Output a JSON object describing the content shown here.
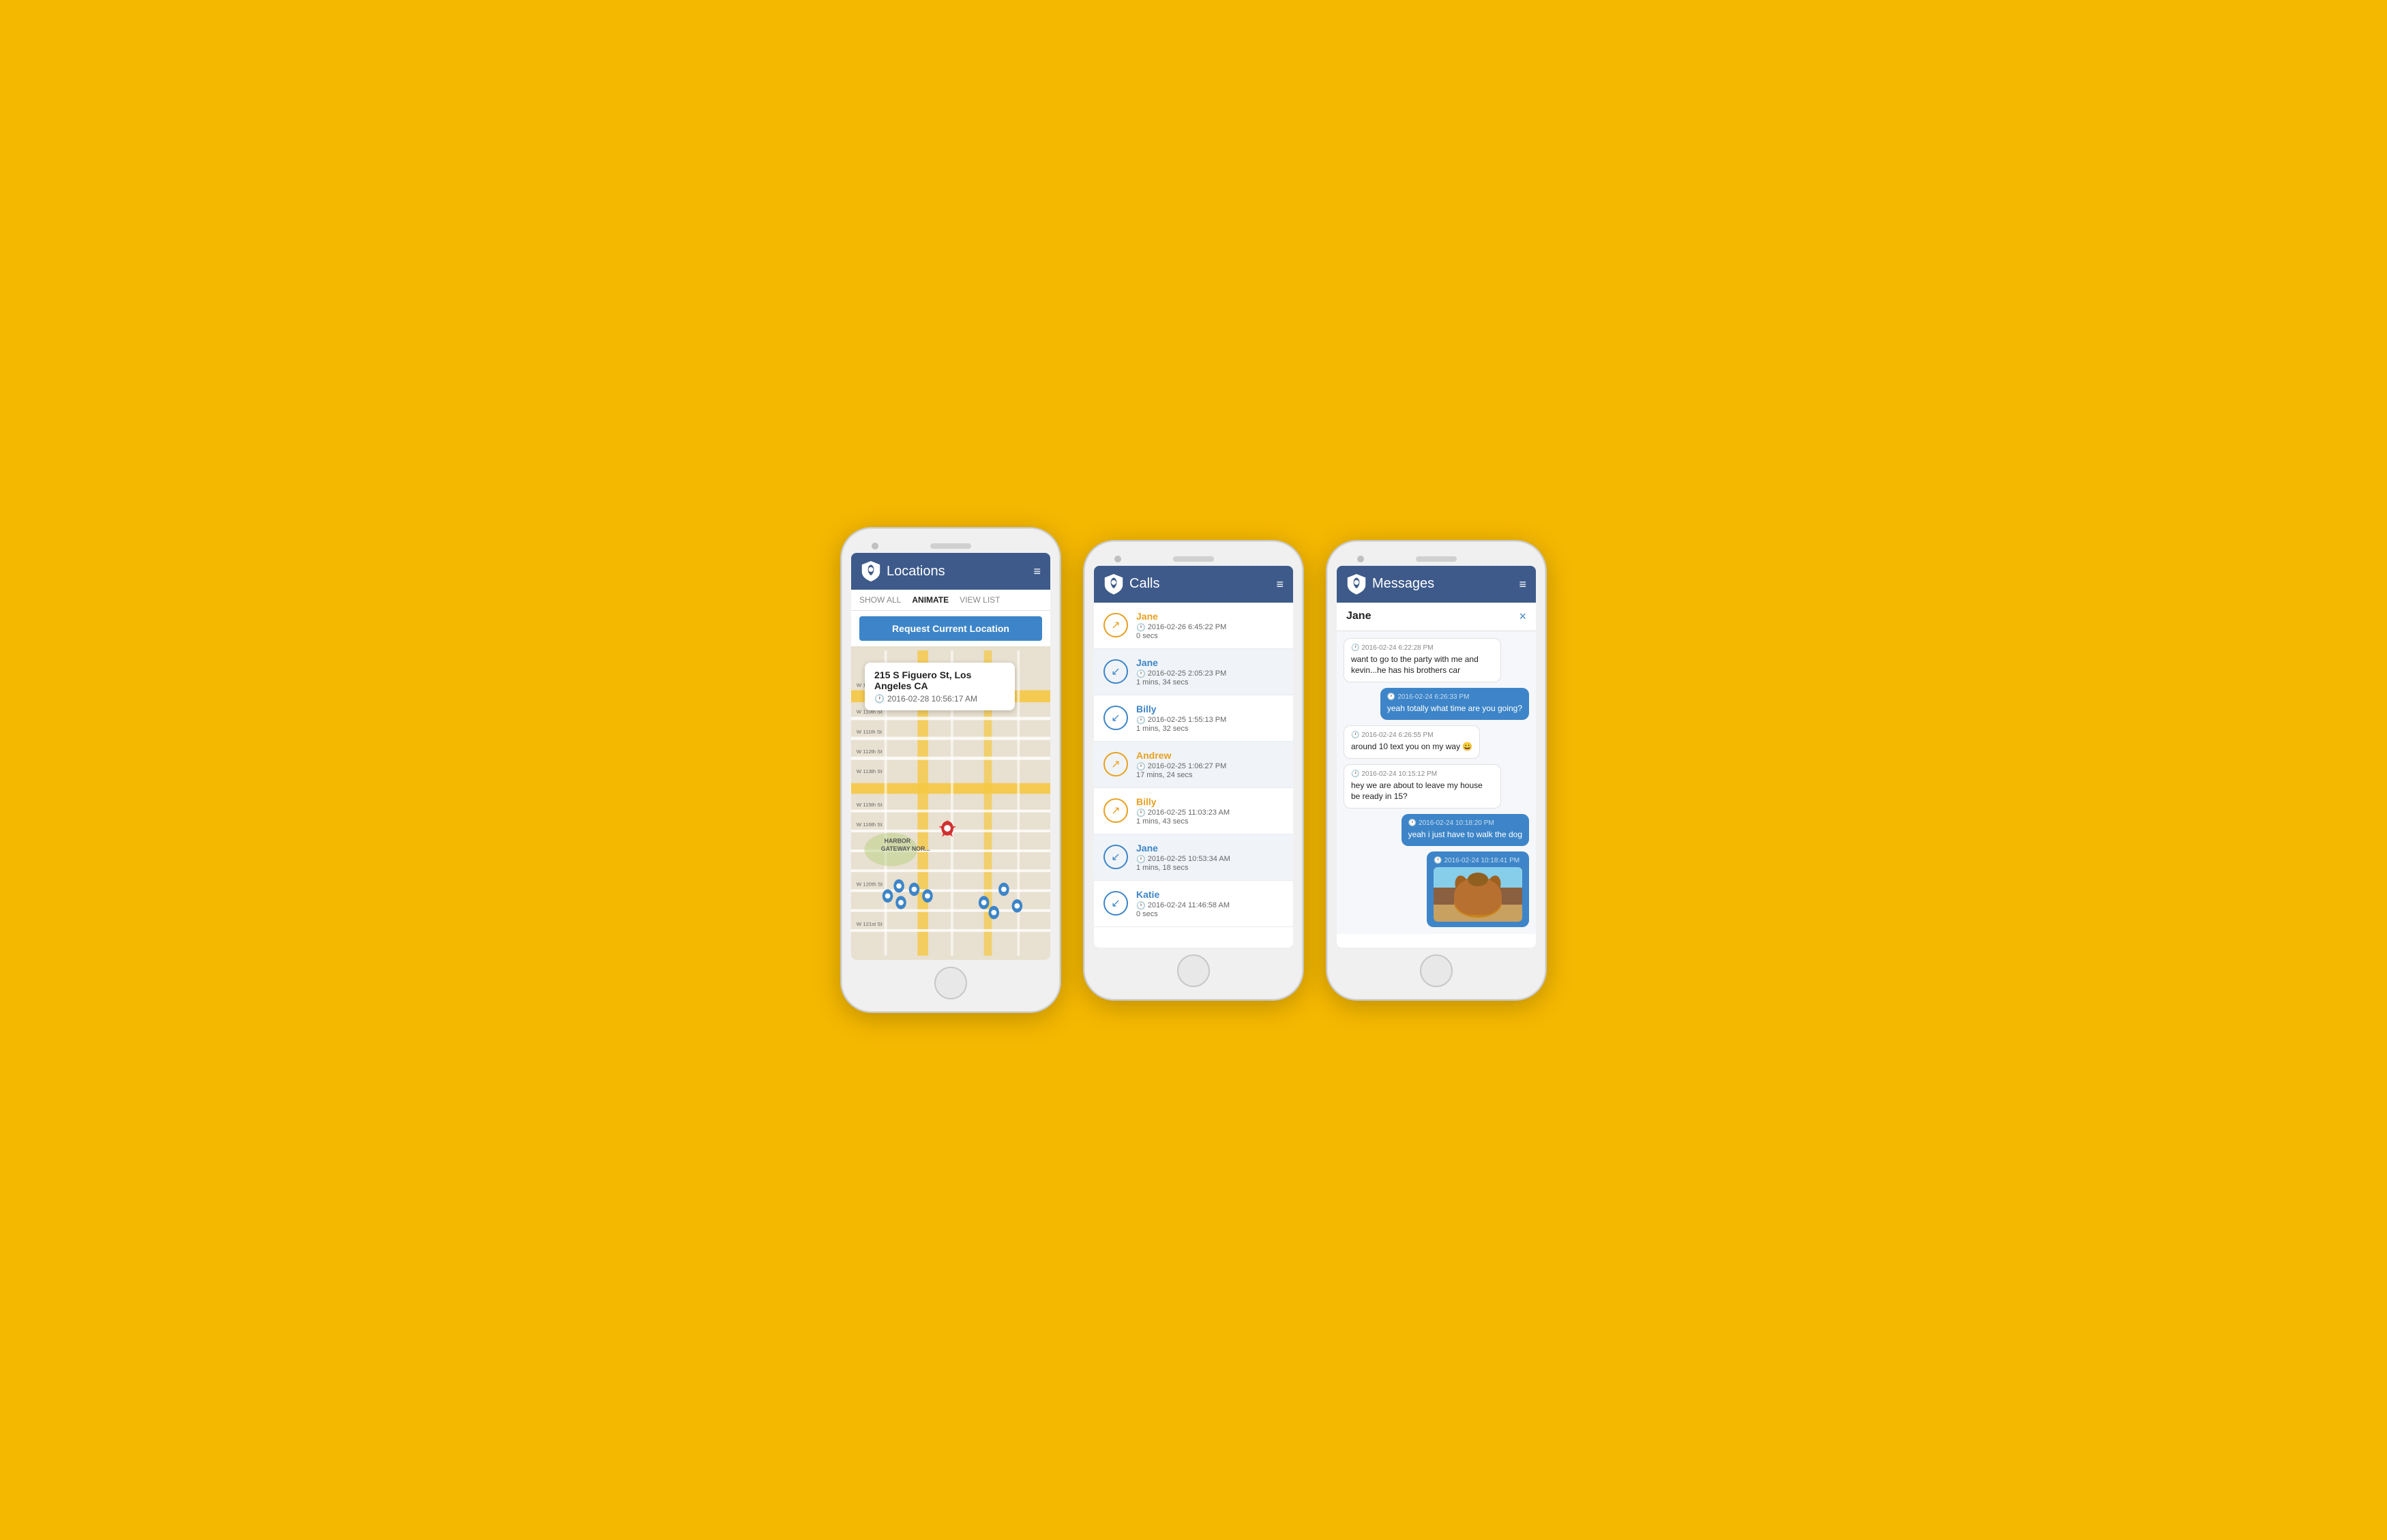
{
  "phone1": {
    "header": {
      "title": "Locations",
      "icon_alt": "shield-icon"
    },
    "toolbar": [
      {
        "label": "SHOW ALL",
        "active": false
      },
      {
        "label": "ANIMATE",
        "active": true
      },
      {
        "label": "VIEW LIST",
        "active": false
      }
    ],
    "request_btn": "Request Current Location",
    "map_popup": {
      "address": "215 S Figuero St, Los Angeles CA",
      "time": "2016-02-28 10:56:17 AM"
    }
  },
  "phone2": {
    "header": {
      "title": "Calls"
    },
    "calls": [
      {
        "name": "Jane",
        "color": "orange",
        "datetime": "2016-02-26 6:45:22 PM",
        "duration": "0 secs",
        "icon": "outgoing"
      },
      {
        "name": "Jane",
        "color": "blue",
        "datetime": "2016-02-25 2:05:23 PM",
        "duration": "1 mins, 34 secs",
        "icon": "incoming"
      },
      {
        "name": "Billy",
        "color": "blue",
        "datetime": "2016-02-25 1:55:13 PM",
        "duration": "1 mins, 32 secs",
        "icon": "incoming"
      },
      {
        "name": "Andrew",
        "color": "orange",
        "datetime": "2016-02-25 1:06:27 PM",
        "duration": "17 mins, 24 secs",
        "icon": "outgoing"
      },
      {
        "name": "Billy",
        "color": "orange",
        "datetime": "2016-02-25 11:03:23 AM",
        "duration": "1 mins, 43 secs",
        "icon": "outgoing"
      },
      {
        "name": "Jane",
        "color": "blue",
        "datetime": "2016-02-25 10:53:34 AM",
        "duration": "1 mins, 18 secs",
        "icon": "incoming"
      },
      {
        "name": "Katie",
        "color": "blue",
        "datetime": "2016-02-24 11:46:58 AM",
        "duration": "0 secs",
        "icon": "incoming"
      }
    ]
  },
  "phone3": {
    "header": {
      "title": "Messages"
    },
    "contact": "Jane",
    "close": "×",
    "messages": [
      {
        "type": "received",
        "time": "2016-02-24 6:22:28 PM",
        "text": "want to go to the party with me and kevin...he has his brothers car",
        "has_image": false
      },
      {
        "type": "sent",
        "time": "2016-02-24 6:26:33 PM",
        "text": "yeah totally what time are you going?",
        "has_image": false
      },
      {
        "type": "received",
        "time": "2016-02-24 6:26:55 PM",
        "text": "around 10 text you on my way 😀",
        "has_image": false
      },
      {
        "type": "received",
        "time": "2016-02-24 10:15:12 PM",
        "text": "hey we are about to leave my house be ready in 15?",
        "has_image": false
      },
      {
        "type": "sent",
        "time": "2016-02-24 10:18:20 PM",
        "text": "yeah i just have to walk the dog",
        "has_image": false
      },
      {
        "type": "sent",
        "time": "2016-02-24 10:18:41 PM",
        "text": "",
        "has_image": true
      }
    ]
  },
  "ui": {
    "hamburger": "≡",
    "clock_symbol": "🕐",
    "separator": "|"
  }
}
